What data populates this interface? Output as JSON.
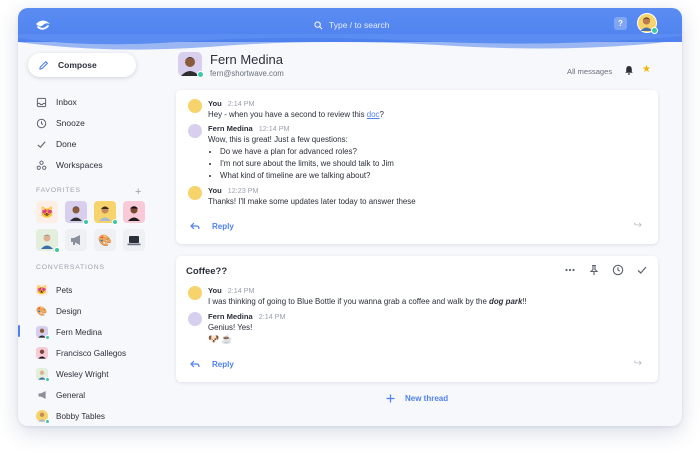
{
  "topbar": {
    "search_placeholder": "Type / to search",
    "help_label": "?"
  },
  "sidebar": {
    "compose_label": "Compose",
    "nav": [
      {
        "label": "Inbox",
        "icon": "inbox-icon"
      },
      {
        "label": "Snooze",
        "icon": "clock-icon"
      },
      {
        "label": "Done",
        "icon": "check-icon"
      },
      {
        "label": "Workspaces",
        "icon": "workspaces-icon"
      }
    ],
    "favorites_label": "FAVORITES",
    "favorites_add": "+",
    "conversations_label": "CONVERSATIONS",
    "conversations": [
      {
        "label": "Pets"
      },
      {
        "label": "Design"
      },
      {
        "label": "Fern Medina"
      },
      {
        "label": "Francisco Gallegos"
      },
      {
        "label": "Wesley Wright"
      },
      {
        "label": "General"
      },
      {
        "label": "Bobby Tables"
      }
    ]
  },
  "contact": {
    "name": "Fern Medina",
    "email": "fern@shortwave.com",
    "filter_label": "All messages"
  },
  "thread1": {
    "messages": [
      {
        "who": "You",
        "time": "2:14 PM",
        "text_before": "Hey - when you have a second to review this ",
        "link": "doc",
        "text_after": "?"
      },
      {
        "who": "Fern Medina",
        "time": "12:14 PM",
        "text": "Wow, this is great!  Just a few questions:",
        "bullets": [
          "Do we have a plan for advanced roles?",
          "I'm not sure about the limits, we should talk to Jim",
          "What kind of timeline are we talking about?"
        ]
      },
      {
        "who": "You",
        "time": "12:23 PM",
        "text": "Thanks! I'll make some updates later today to answer these"
      }
    ],
    "reply_label": "Reply"
  },
  "thread2": {
    "title": "Coffee??",
    "messages": [
      {
        "who": "You",
        "time": "2:14 PM",
        "text_before": "I was thinking of going to Blue Bottle if you wanna grab a coffee and walk by the ",
        "emph": "dog park",
        "text_after": "!!"
      },
      {
        "who": "Fern Medina",
        "time": "2:14 PM",
        "text": "Genius!  Yes!",
        "emoji": "🐶☕"
      }
    ],
    "reply_label": "Reply"
  },
  "new_thread_label": "New thread",
  "colors": {
    "accent": "#4f82ef",
    "online": "#3cc7a6",
    "star": "#f5b400"
  }
}
